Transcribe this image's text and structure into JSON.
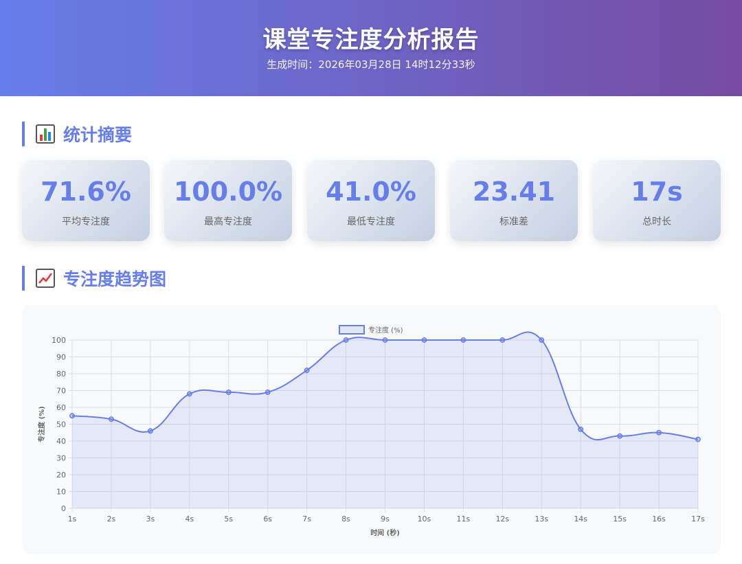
{
  "header": {
    "title": "课堂专注度分析报告",
    "generated_at": "生成时间：2026年03月28日 14时12分33秒"
  },
  "sections": {
    "summary": {
      "icon": "bar-chart-icon",
      "title": "统计摘要"
    },
    "trend": {
      "icon": "trend-chart-icon",
      "title": "专注度趋势图"
    }
  },
  "stats": [
    {
      "value": "71.6%",
      "label": "平均专注度"
    },
    {
      "value": "100.0%",
      "label": "最高专注度"
    },
    {
      "value": "41.0%",
      "label": "最低专注度"
    },
    {
      "value": "23.41",
      "label": "标准差"
    },
    {
      "value": "17s",
      "label": "总时长"
    }
  ],
  "colors": {
    "accent": "#667eea",
    "header_gradient_start": "#667eea",
    "header_gradient_end": "#764ba2"
  },
  "chart_data": {
    "type": "line",
    "categories": [
      "1s",
      "2s",
      "3s",
      "4s",
      "5s",
      "6s",
      "7s",
      "8s",
      "9s",
      "10s",
      "11s",
      "12s",
      "13s",
      "14s",
      "15s",
      "16s",
      "17s"
    ],
    "series": [
      {
        "name": "专注度 (%)",
        "values": [
          55,
          53,
          46,
          68,
          69,
          69,
          82,
          100,
          100,
          100,
          100,
          100,
          100,
          47,
          43,
          45,
          41
        ]
      }
    ],
    "title": "",
    "xlabel": "时间 (秒)",
    "ylabel": "专注度 (%)",
    "ylim": [
      0,
      100
    ],
    "yticks": [
      0,
      10,
      20,
      30,
      40,
      50,
      60,
      70,
      80,
      90,
      100
    ],
    "grid": true,
    "fill": true,
    "legend_position": "top-center"
  }
}
